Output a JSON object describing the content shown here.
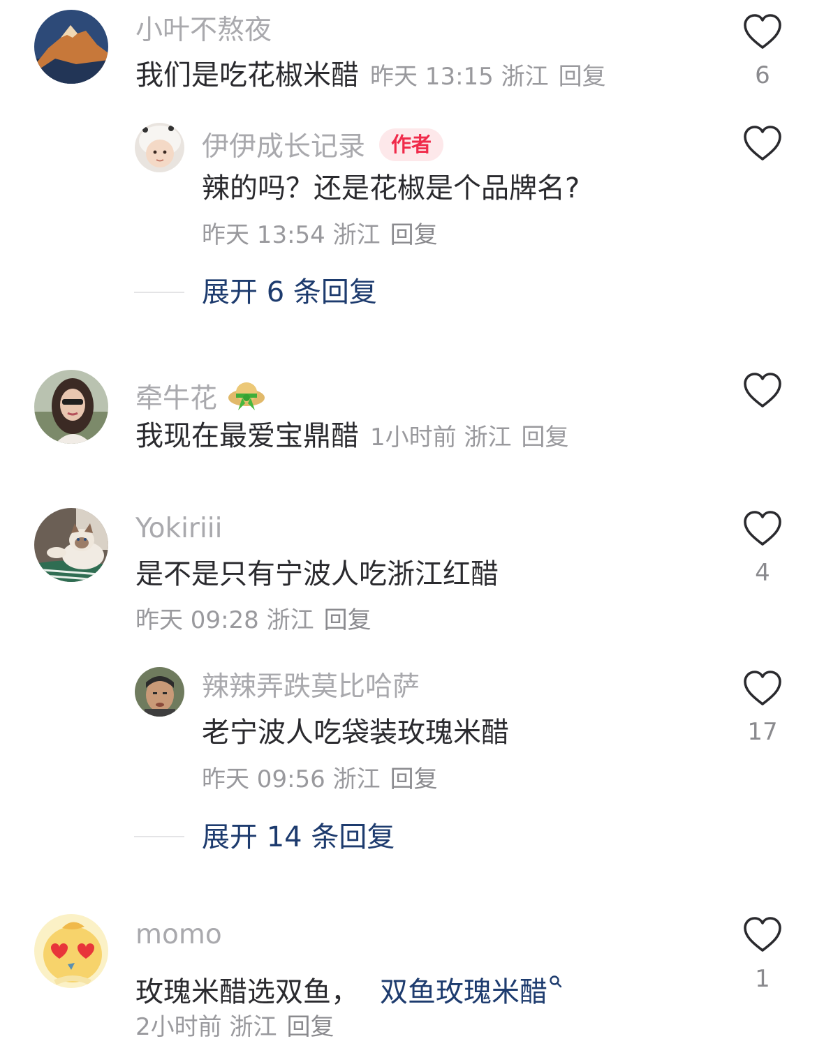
{
  "comments": [
    {
      "username": "小叶不熬夜",
      "text": "我们是吃花椒米醋",
      "time": "昨天 13:15",
      "location": "浙江",
      "reply_label": "回复",
      "like_count": "6",
      "avatar_icon": "mountain-avatar",
      "replies": [
        {
          "username": "伊伊成长记录",
          "badge": "作者",
          "text": "辣的吗？还是花椒是个品牌名?",
          "time": "昨天 13:54",
          "location": "浙江",
          "reply_label": "回复",
          "like_count": "",
          "avatar_icon": "baby-avatar"
        }
      ],
      "expand_label": "展开 6 条回复"
    },
    {
      "username": "牵牛花",
      "text": "我现在最爱宝鼎醋",
      "time": "1小时前",
      "location": "浙江",
      "reply_label": "回复",
      "like_count": "",
      "avatar_icon": "woman-avatar",
      "user_badge_icon": "green-hat-icon"
    },
    {
      "username": "Yokiriii",
      "text": "是不是只有宁波人吃浙江红醋",
      "time": "昨天 09:28",
      "location": "浙江",
      "reply_label": "回复",
      "like_count": "4",
      "avatar_icon": "cat-avatar",
      "replies": [
        {
          "username": "辣辣弄跌莫比哈萨",
          "text": "老宁波人吃袋装玫瑰米醋",
          "time": "昨天 09:56",
          "location": "浙江",
          "reply_label": "回复",
          "like_count": "17",
          "avatar_icon": "man-avatar"
        }
      ],
      "expand_label": "展开 14 条回复"
    },
    {
      "username": "momo",
      "text": "玫瑰米醋选双鱼，",
      "link_text": "双鱼玫瑰米醋",
      "time": "2小时前",
      "location": "浙江",
      "reply_label": "回复",
      "like_count": "1",
      "avatar_icon": "emoji-avatar"
    }
  ],
  "colors": {
    "username": "#a9a9ad",
    "text": "#2a2a2e",
    "meta": "#99999d",
    "link": "#1d3b6e",
    "author_badge_bg": "#fde8ea",
    "author_badge_text": "#f02a4a"
  }
}
